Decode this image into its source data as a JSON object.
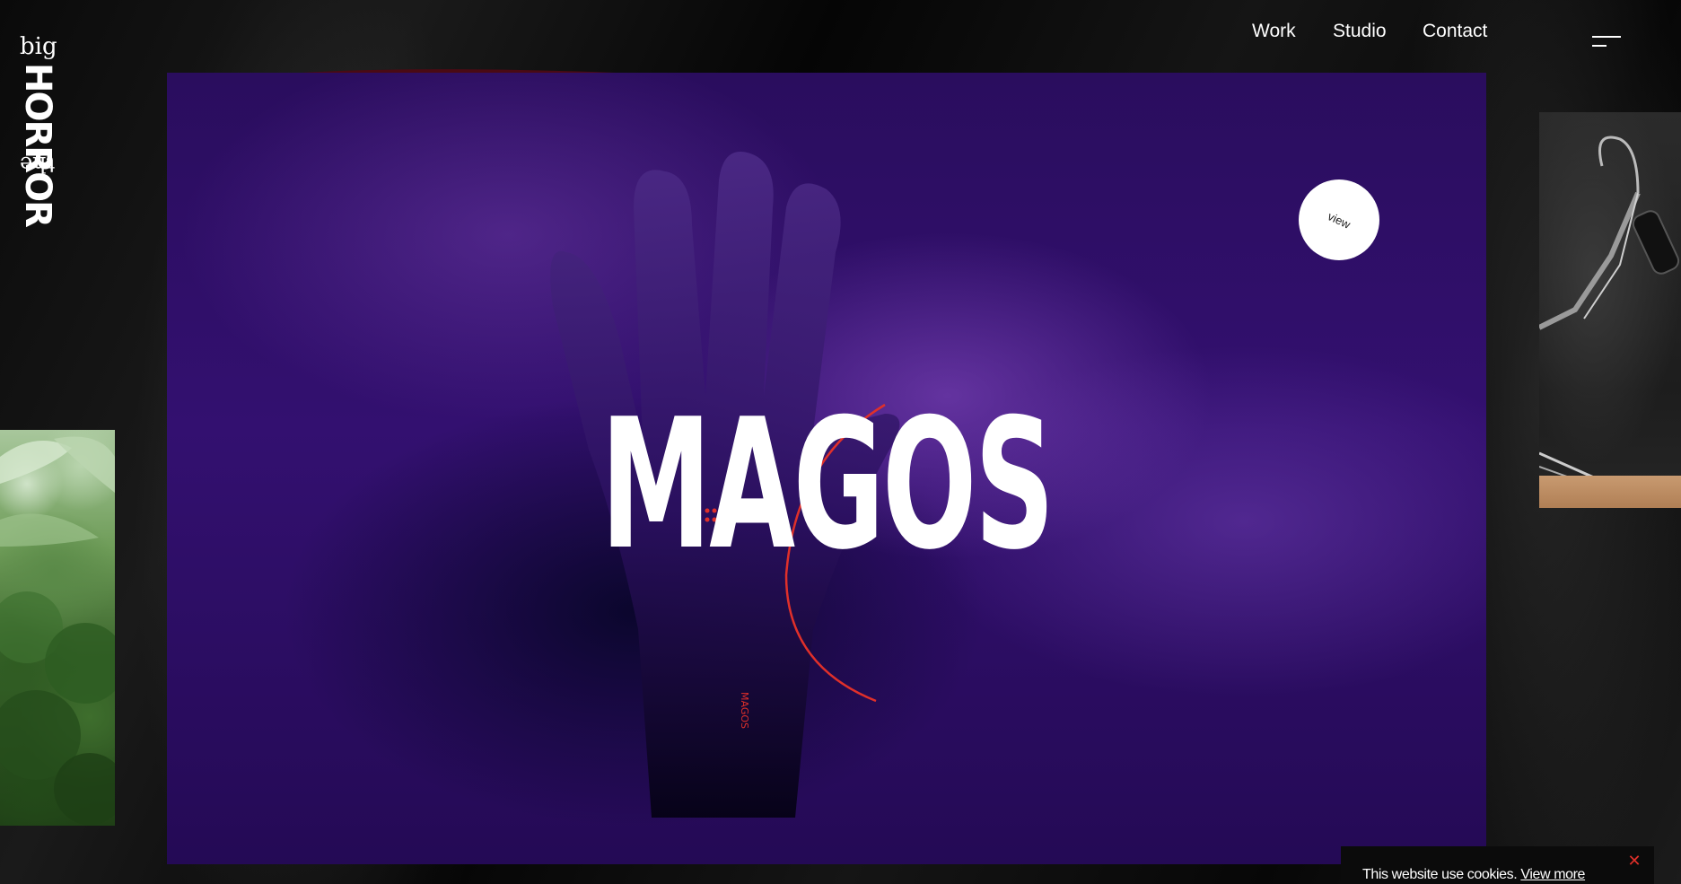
{
  "brand": {
    "line1": "big",
    "line2": "HORROR",
    "line3": "the"
  },
  "nav": {
    "items": [
      {
        "label": "Work"
      },
      {
        "label": "Studio"
      },
      {
        "label": "Contact"
      }
    ],
    "menu_icon": "hamburger-icon"
  },
  "hero": {
    "title": "MAGOS",
    "view_label": "view",
    "glove_text": "MAGOS"
  },
  "cookie": {
    "message": "This website use cookies.",
    "link_label": "View more",
    "close_icon": "close-icon",
    "close_color": "#e0302a"
  },
  "colors": {
    "hero_purple": "#2a0d5e",
    "accent_red": "#e0302a"
  }
}
